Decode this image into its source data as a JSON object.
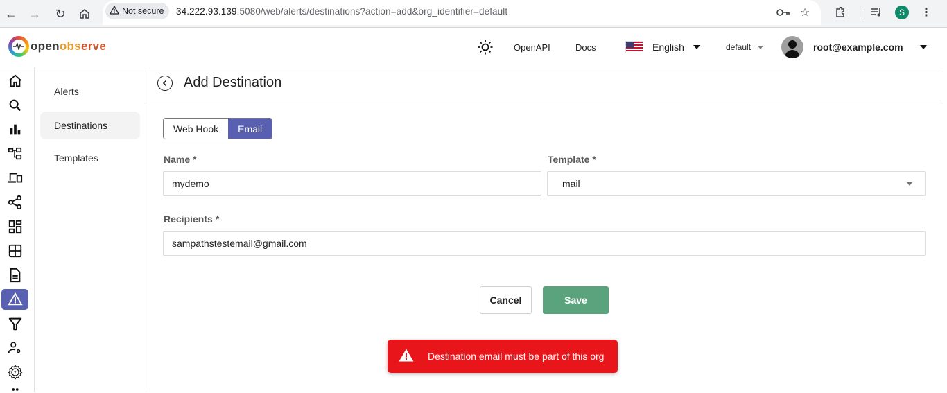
{
  "browser": {
    "security_label": "Not secure",
    "url_host": "34.222.93.139",
    "url_rest": ":5080/web/alerts/destinations?action=add&org_identifier=default",
    "profile_initial": "S"
  },
  "header": {
    "logo_parts": [
      "open",
      "obs",
      "erve"
    ],
    "openapi_label": "OpenAPI",
    "docs_label": "Docs",
    "language": "English",
    "org": "default",
    "user": "root@example.com"
  },
  "rail": {
    "items": [
      {
        "name": "home",
        "active": false
      },
      {
        "name": "search",
        "active": false
      },
      {
        "name": "metrics",
        "active": false
      },
      {
        "name": "traces",
        "active": false
      },
      {
        "name": "rum",
        "active": false
      },
      {
        "name": "pipelines",
        "active": false
      },
      {
        "name": "dashboards",
        "active": false
      },
      {
        "name": "streams",
        "active": false
      },
      {
        "name": "reports",
        "active": false
      },
      {
        "name": "alerts",
        "active": true
      },
      {
        "name": "functions",
        "active": false
      },
      {
        "name": "iam",
        "active": false
      },
      {
        "name": "settings-help",
        "active": false
      }
    ]
  },
  "subnav": {
    "items": [
      {
        "label": "Alerts",
        "active": false
      },
      {
        "label": "Destinations",
        "active": true
      },
      {
        "label": "Templates",
        "active": false
      }
    ]
  },
  "page": {
    "title": "Add Destination",
    "type_toggle": [
      {
        "label": "Web Hook",
        "active": false
      },
      {
        "label": "Email",
        "active": true
      }
    ],
    "name_label": "Name *",
    "name_value": "mydemo",
    "template_label": "Template *",
    "template_value": "mail",
    "recipients_label": "Recipients *",
    "recipients_value": "sampathstestemail@gmail.com",
    "cancel_label": "Cancel",
    "save_label": "Save"
  },
  "toast": {
    "type": "error",
    "message": "Destination email must be part of this org"
  },
  "colors": {
    "accent": "#5960b2",
    "save": "#5ba37d",
    "error": "#e8161b"
  }
}
